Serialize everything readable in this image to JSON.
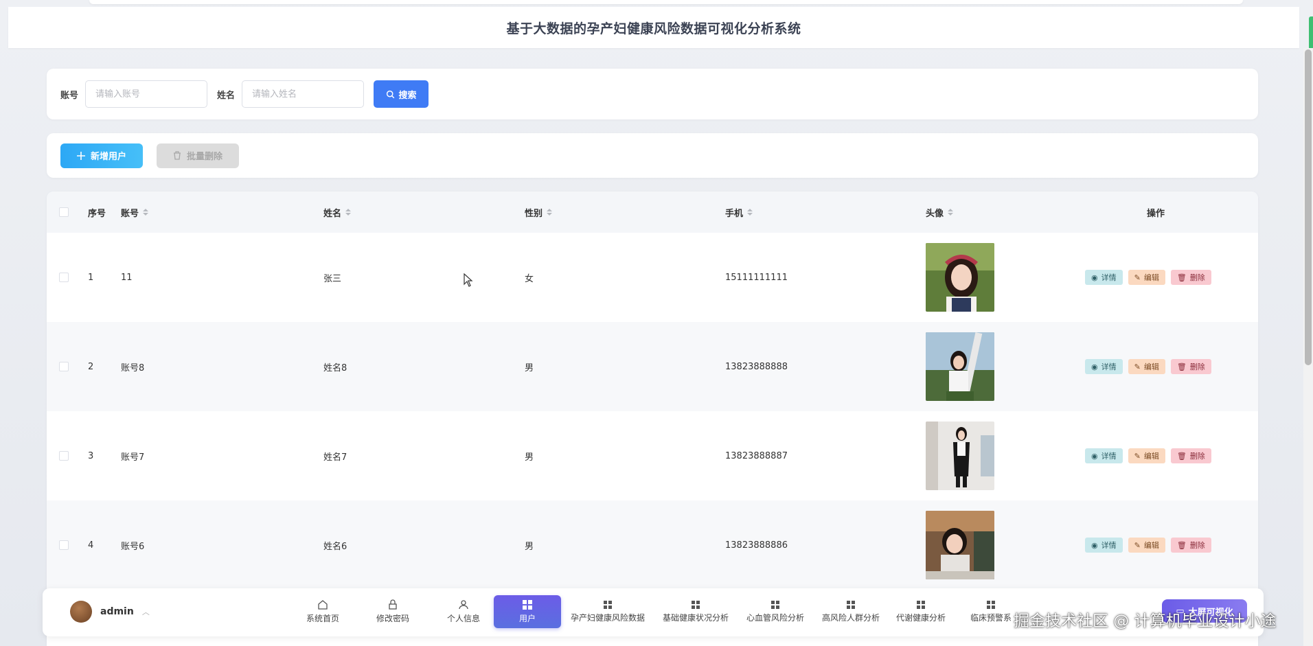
{
  "header": {
    "title": "基于大数据的孕产妇健康风险数据可视化分析系统"
  },
  "search": {
    "account_label": "账号",
    "account_placeholder": "请输入账号",
    "name_label": "姓名",
    "name_placeholder": "请输入姓名",
    "search_button": "搜索"
  },
  "actions": {
    "add_button": "新增用户",
    "batch_delete_button": "批量删除"
  },
  "table": {
    "columns": [
      "序号",
      "账号",
      "姓名",
      "性别",
      "手机",
      "头像",
      "操作"
    ],
    "rows": [
      {
        "index": "1",
        "account": "11",
        "name": "张三",
        "gender": "女",
        "phone": "15111111111"
      },
      {
        "index": "2",
        "account": "账号8",
        "name": "姓名8",
        "gender": "男",
        "phone": "13823888888"
      },
      {
        "index": "3",
        "account": "账号7",
        "name": "姓名7",
        "gender": "男",
        "phone": "13823888887"
      },
      {
        "index": "4",
        "account": "账号6",
        "name": "姓名6",
        "gender": "男",
        "phone": "13823888886"
      }
    ],
    "op_labels": {
      "detail": "详情",
      "edit": "编辑",
      "delete": "删除"
    }
  },
  "bottom_nav": {
    "user": "admin",
    "items": [
      "系统首页",
      "修改密码",
      "个人信息",
      "用户",
      "孕产妇健康风险数据",
      "基础健康状况分析",
      "心血管风险分析",
      "高风险人群分析",
      "代谢健康分析",
      "临床预警系"
    ],
    "active": "用户",
    "bigscreen_button": "大屏可视化"
  },
  "watermark": "掘金技术社区 @ 计算机毕业设计小途",
  "colors": {
    "primary": "#3f7bf5",
    "add": "#2da8f5",
    "nav_active": "#6c5ce7"
  }
}
